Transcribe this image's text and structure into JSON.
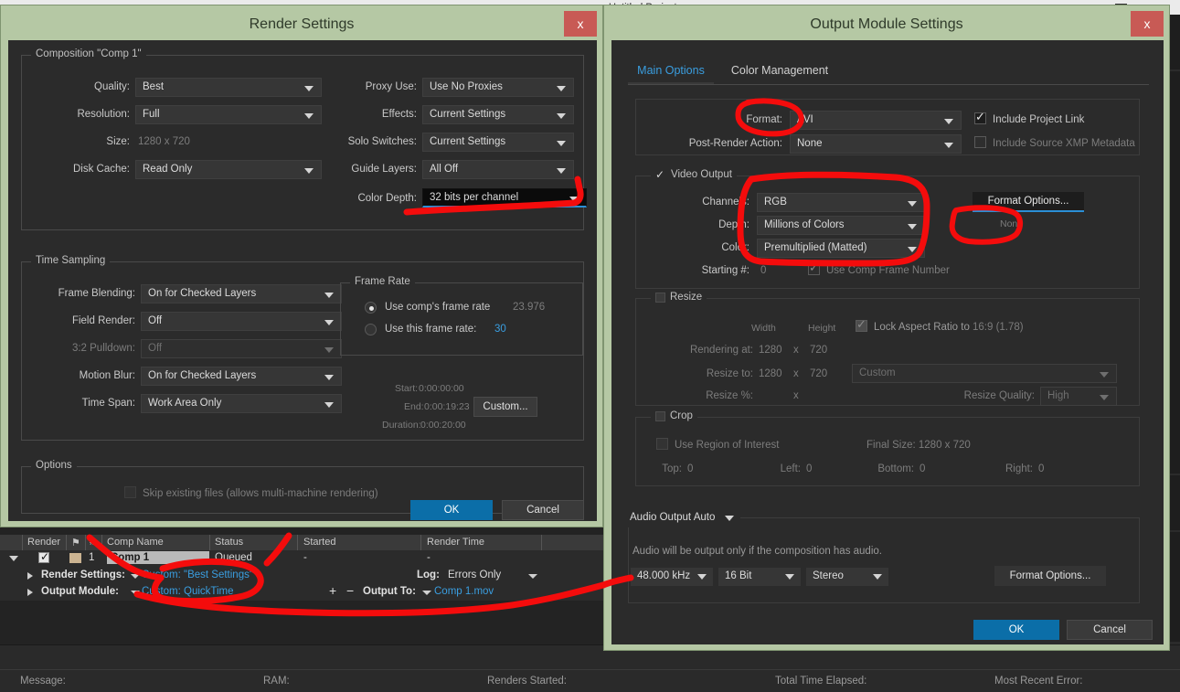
{
  "app": {
    "window_title": "Untitled Project.aep",
    "minimize_icon": "minimize-icon",
    "maximize_icon": "maximize-icon",
    "close_icon": "chevron-down-icon"
  },
  "render_settings": {
    "title": "Render Settings",
    "close_label": "x",
    "composition_group": "Composition \"Comp 1\"",
    "fields_left": [
      {
        "label": "Quality:",
        "value": "Best",
        "type": "dropdown",
        "enabled": true
      },
      {
        "label": "Resolution:",
        "value": "Full",
        "type": "dropdown",
        "enabled": true
      },
      {
        "label": "Size:",
        "value": "1280 x 720",
        "type": "text",
        "enabled": true
      },
      {
        "label": "Disk Cache:",
        "value": "Read Only",
        "type": "dropdown",
        "enabled": true
      }
    ],
    "fields_right": [
      {
        "label": "Proxy Use:",
        "value": "Use No Proxies",
        "type": "dropdown",
        "enabled": true
      },
      {
        "label": "Effects:",
        "value": "Current Settings",
        "type": "dropdown",
        "enabled": true
      },
      {
        "label": "Solo Switches:",
        "value": "Current Settings",
        "type": "dropdown",
        "enabled": true
      },
      {
        "label": "Guide Layers:",
        "value": "All Off",
        "type": "dropdown",
        "enabled": true
      },
      {
        "label": "Color Depth:",
        "value": "32 bits per channel",
        "type": "dropdown",
        "enabled": true,
        "highlighted": true
      }
    ],
    "time_sampling_group": "Time Sampling",
    "time_fields": [
      {
        "label": "Frame Blending:",
        "value": "On for Checked Layers",
        "enabled": true
      },
      {
        "label": "Field Render:",
        "value": "Off",
        "enabled": true
      },
      {
        "label": "3:2 Pulldown:",
        "value": "Off",
        "enabled": false
      },
      {
        "label": "Motion Blur:",
        "value": "On for Checked Layers",
        "enabled": true
      },
      {
        "label": "Time Span:",
        "value": "Work Area Only",
        "enabled": true
      }
    ],
    "frame_rate_group": "Frame Rate",
    "frame_rate": {
      "use_comp_label": "Use comp's frame rate",
      "use_comp_value": "23.976",
      "use_comp_selected": true,
      "use_this_label": "Use this frame rate:",
      "use_this_value": "30",
      "use_this_selected": false
    },
    "timing": {
      "start_label": "Start:",
      "start_value": "0:00:00:00",
      "end_label": "End:",
      "end_value": "0:00:19:23",
      "duration_label": "Duration:",
      "duration_value": "0:00:20:00",
      "custom_button": "Custom..."
    },
    "options_group": "Options",
    "skip_existing_label": "Skip existing files (allows multi-machine rendering)",
    "skip_existing_checked": false,
    "ok_label": "OK",
    "cancel_label": "Cancel"
  },
  "output_module": {
    "title": "Output Module Settings",
    "close_label": "x",
    "tabs": [
      {
        "label": "Main Options",
        "active": true
      },
      {
        "label": "Color Management",
        "active": false
      }
    ],
    "format_label": "Format:",
    "format_value": "AVI",
    "post_render_label": "Post-Render Action:",
    "post_render_value": "None",
    "include_project_link_label": "Include Project Link",
    "include_project_link_checked": true,
    "include_xmp_label": "Include Source XMP Metadata",
    "include_xmp_checked": false,
    "video_output_group": "Video Output",
    "video_output_checked": true,
    "channels_label": "Channels:",
    "channels_value": "RGB",
    "depth_label": "Depth:",
    "depth_value": "Millions of Colors",
    "color_label": "Color:",
    "color_value": "Premultiplied (Matted)",
    "starting_label": "Starting #:",
    "starting_value": "0",
    "use_comp_frame_number_label": "Use Comp Frame Number",
    "use_comp_frame_number_checked": true,
    "format_options_button": "Format Options...",
    "format_options_status": "None",
    "resize_group": "Resize",
    "resize_checked": false,
    "width_header": "Width",
    "height_header": "Height",
    "lock_aspect_label": "Lock Aspect Ratio to",
    "lock_aspect_value": "16:9 (1.78)",
    "lock_aspect_checked": true,
    "rendering_at_label": "Rendering at:",
    "rendering_at_w": "1280",
    "rendering_at_h": "720",
    "resize_to_label": "Resize to:",
    "resize_to_w": "1280",
    "resize_to_h": "720",
    "resize_preset": "Custom",
    "resize_pct_label": "Resize %:",
    "resize_quality_label": "Resize Quality:",
    "resize_quality_value": "High",
    "x_separator": "x",
    "crop_group": "Crop",
    "crop_checked": false,
    "use_roi_label": "Use Region of Interest",
    "use_roi_checked": false,
    "final_size_label": "Final Size: 1280 x 720",
    "crop_top_label": "Top:",
    "crop_top_value": "0",
    "crop_left_label": "Left:",
    "crop_left_value": "0",
    "crop_bottom_label": "Bottom:",
    "crop_bottom_value": "0",
    "crop_right_label": "Right:",
    "crop_right_value": "0",
    "audio_output_value": "Audio Output Auto",
    "audio_note": "Audio will be output only if the composition has audio.",
    "audio_rate": "48.000 kHz",
    "audio_depth": "16 Bit",
    "audio_channels": "Stereo",
    "audio_format_options_button": "Format Options...",
    "ok_label": "OK",
    "cancel_label": "Cancel"
  },
  "render_queue": {
    "columns": [
      "Render",
      "⚑",
      "#",
      "Comp Name",
      "Status",
      "Started",
      "Render Time"
    ],
    "row": {
      "render_checked": true,
      "number": "1",
      "comp_name": "Comp 1",
      "status": "Queued",
      "started": "-",
      "render_time": "-"
    },
    "render_settings_label": "Render Settings:",
    "render_settings_value": "Custom: \"Best Settings\"",
    "output_module_label": "Output Module:",
    "output_module_value": "Custom: QuickTime",
    "log_label": "Log:",
    "log_value": "Errors Only",
    "output_to_label": "Output To:",
    "output_to_value": "Comp 1.mov",
    "plus_label": "+",
    "minus_label": "−"
  },
  "status_bar": {
    "message_label": "Message:",
    "ram_label": "RAM:",
    "renders_started_label": "Renders Started:",
    "total_time_label": "Total Time Elapsed:",
    "most_recent_error_label": "Most Recent Error:"
  },
  "colors": {
    "accent_blue": "#0b6ea8",
    "link_blue": "#3a9ee0",
    "dialog_chrome": "#b5c8a4",
    "close_red": "#c85a55",
    "annotation_red": "#f40c0c",
    "panel_bg": "#2b2b2b"
  }
}
